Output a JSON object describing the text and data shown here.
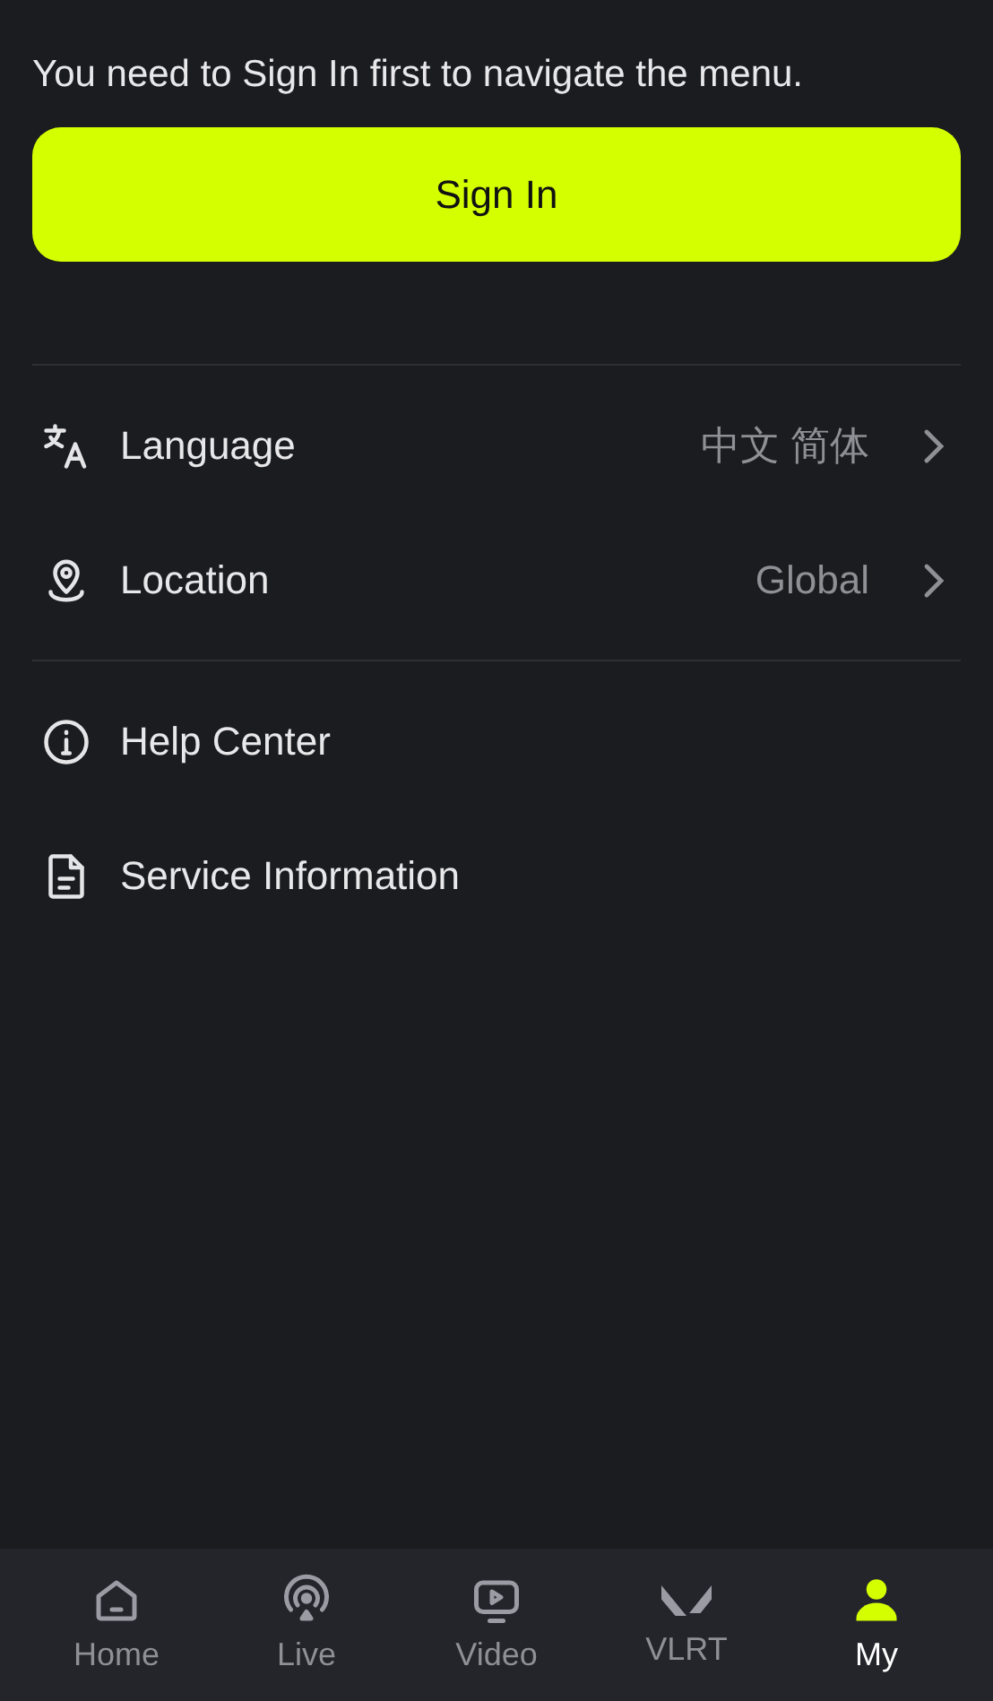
{
  "prompt": "You need to Sign In first to navigate the menu.",
  "sign_in_button": "Sign In",
  "sections": [
    {
      "items": [
        {
          "kind": "language",
          "label": "Language",
          "value": "中文 简体"
        },
        {
          "kind": "location",
          "label": "Location",
          "value": "Global"
        }
      ]
    },
    {
      "items": [
        {
          "kind": "help",
          "label": "Help Center"
        },
        {
          "kind": "service",
          "label": "Service Information"
        }
      ]
    }
  ],
  "tabs": [
    {
      "kind": "home",
      "label": "Home",
      "selected": false
    },
    {
      "kind": "live",
      "label": "Live",
      "selected": false
    },
    {
      "kind": "video",
      "label": "Video",
      "selected": false
    },
    {
      "kind": "vlrt",
      "label": "VLRT",
      "selected": false
    },
    {
      "kind": "my",
      "label": "My",
      "selected": true
    }
  ]
}
